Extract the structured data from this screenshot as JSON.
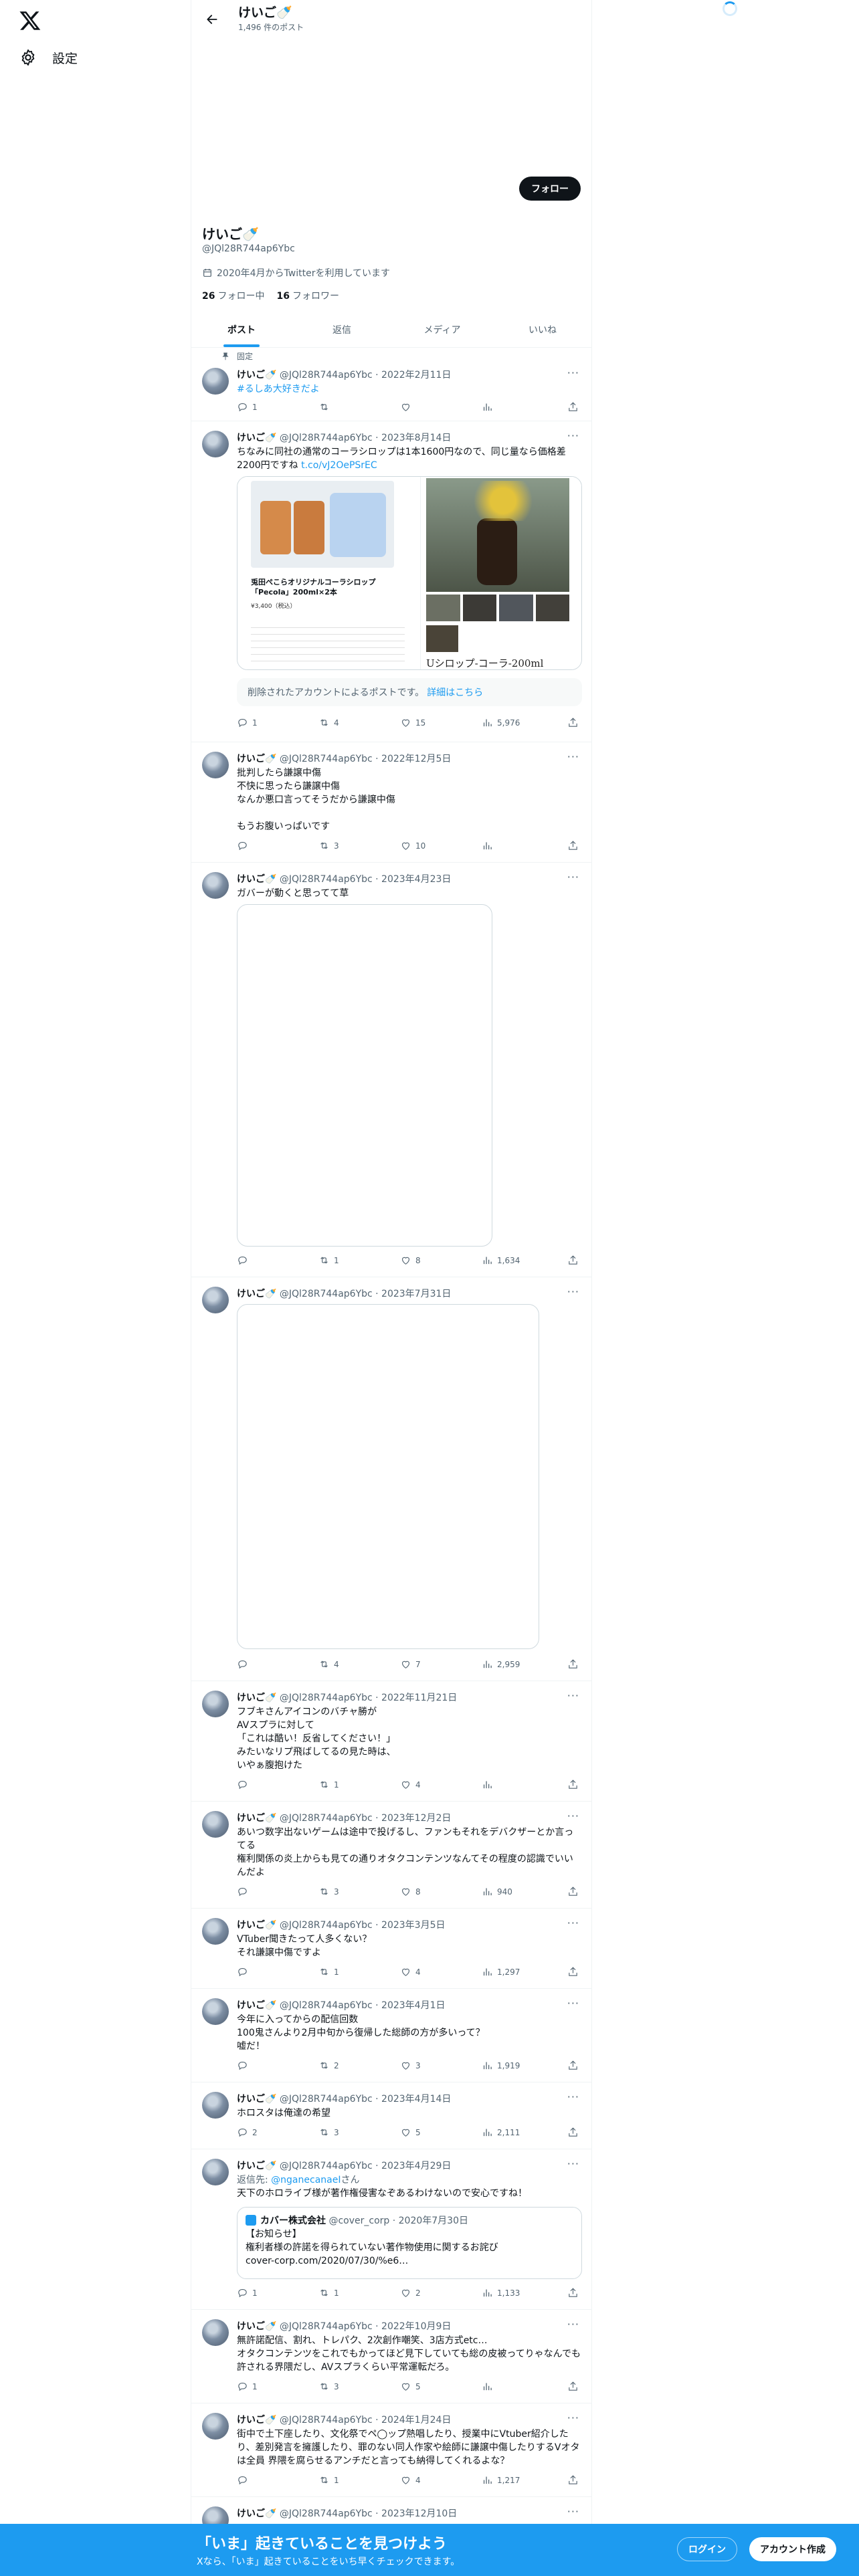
{
  "colors": {
    "accent": "#1d9bf0",
    "text": "#0f1419",
    "muted": "#536471"
  },
  "left": {
    "settings_label": "設定"
  },
  "header": {
    "name": "けいご🍼",
    "post_count": "1,496 件のポスト"
  },
  "profile": {
    "follow_label": "フォロー",
    "name": "けいご🍼",
    "handle": "@JQl28R744ap6Ybc",
    "joined": "2020年4月からTwitterを利用しています",
    "following_count": "26",
    "following_label": "フォロー中",
    "followers_count": "16",
    "followers_label": "フォロワー"
  },
  "tabs": [
    "ポスト",
    "返信",
    "メディア",
    "いいね"
  ],
  "pinned_label": "固定",
  "tweets": [
    {
      "name": "けいご🍼",
      "meta": "@JQl28R744ap6Ybc · 2022年2月11日",
      "text": "",
      "hashtag": "#るしあ大好きだよ",
      "reply": "1",
      "retweet": "",
      "like": "",
      "views": ""
    },
    {
      "name": "けいご🍼",
      "meta": "@JQl28R744ap6Ybc · 2023年8月14日",
      "text": "ちなみに同社の通常のコーラシロップは1本1600円なので、同じ量なら価格差2200円ですね ",
      "link": "t.co/vJ2OePSrEC",
      "card_left_title": "兎田ぺこらオリジナルコーラシロップ「Pecola」200ml×2本",
      "card_left_price": "¥3,400（税込）",
      "card_right_label": "Uシロップ-コーラ-200ml",
      "deleted_text": "削除されたアカウントによるポストです。",
      "deleted_link": "詳細はこちら",
      "reply": "1",
      "retweet": "4",
      "like": "15",
      "views": "5,976"
    },
    {
      "name": "けいご🍼",
      "meta": "@JQl28R744ap6Ybc · 2022年12月5日",
      "text": "批判したら謙譲中傷\n不快に思ったら謙譲中傷\nなんか悪口言ってそうだから謙譲中傷\n\nもうお腹いっぱいです",
      "reply": "",
      "retweet": "3",
      "like": "10",
      "views": ""
    },
    {
      "name": "けいご🍼",
      "meta": "@JQl28R744ap6Ybc · 2023年4月23日",
      "text": "ガバーが動くと思ってて草",
      "reply": "",
      "retweet": "1",
      "like": "8",
      "views": "1,634"
    },
    {
      "name": "けいご🍼",
      "meta": "@JQl28R744ap6Ybc · 2023年7月31日",
      "text": "",
      "reply": "",
      "retweet": "4",
      "like": "7",
      "views": "2,959"
    },
    {
      "name": "けいご🍼",
      "meta": "@JQl28R744ap6Ybc · 2022年11月21日",
      "text": "フブキさんアイコンのバチャ勝が\nAVスプラに対して\n「これは酷い！反省してください！」\nみたいなリプ飛ばしてるの見た時は、\nいやぁ腹抱けた",
      "reply": "",
      "retweet": "1",
      "like": "4",
      "views": ""
    },
    {
      "name": "けいご🍼",
      "meta": "@JQl28R744ap6Ybc · 2023年12月2日",
      "text": "あいつ数字出ないゲームは途中で投げるし、ファンもそれをデバクザーとか言ってる\n権利関係の炎上からも見ての通りオタクコンテンツなんてその程度の認識でいいんだよ",
      "reply": "",
      "retweet": "3",
      "like": "8",
      "views": "940"
    },
    {
      "name": "けいご🍼",
      "meta": "@JQl28R744ap6Ybc · 2023年3月5日",
      "text": "VTuber聞きたって人多くない？\nそれ謙譲中傷ですよ",
      "reply": "",
      "retweet": "1",
      "like": "4",
      "views": "1,297"
    },
    {
      "name": "けいご🍼",
      "meta": "@JQl28R744ap6Ybc · 2023年4月1日",
      "text": "今年に入ってからの配信回数\n100鬼さんより2月中旬から復帰した総師の方が多いって？\n嘘だ！",
      "reply": "",
      "retweet": "2",
      "like": "3",
      "views": "1,919"
    },
    {
      "name": "けいご🍼",
      "meta": "@JQl28R744ap6Ybc · 2023年4月14日",
      "text": "ホロスタは俺達の希望",
      "reply": "2",
      "retweet": "3",
      "like": "5",
      "views": "2,111"
    },
    {
      "name": "けいご🍼",
      "meta": "@JQl28R744ap6Ybc · 2023年4月29日",
      "reply_to_prefix": "返信先: ",
      "reply_to": "@nganecanaeI",
      "reply_to_suffix": "さん",
      "text": "天下のホロライブ様が著作権侵害なぞあるわけないので安心ですね！",
      "quote_name": "カバー株式会社",
      "quote_meta": "@cover_corp · 2020年7月30日",
      "quote_text": "【お知らせ】\n権利者様の許諾を得られていない著作物使用に関するお詫び\ncover-corp.com/2020/07/30/%e6…",
      "reply": "1",
      "retweet": "1",
      "like": "2",
      "views": "1,133"
    },
    {
      "name": "けいご🍼",
      "meta": "@JQl28R744ap6Ybc · 2022年10月9日",
      "text": "無許諾配信、割れ、トレパク、2次創作嘲笑、3店方式etc…\nオタクコンテンツをこれでもかってほど見下していても総の皮被ってりゃなんでも許される界隈だし、AVスプラくらい平常運転だろ。",
      "reply": "1",
      "retweet": "3",
      "like": "5",
      "views": ""
    },
    {
      "name": "けいご🍼",
      "meta": "@JQl28R744ap6Ybc · 2024年1月24日",
      "text": "街中で土下座したり、文化祭でペ◯ップ熱唱したり、授業中にVtuber紹介したり、差別発言を擁護したり、罪のない同人作家や絵師に謙譲中傷したりするVオタは全員 界隈を腐らせるアンチだと言っても納得してくれるよな？",
      "reply": "",
      "retweet": "1",
      "like": "4",
      "views": "1,217"
    },
    {
      "name": "けいご🍼",
      "meta": "@JQl28R744ap6Ybc · 2023年12月10日",
      "text": "",
      "reply": "",
      "retweet": "",
      "like": "",
      "views": ""
    }
  ],
  "bottom": {
    "title": "「いま」起きていることを見つけよう",
    "subtitle": "Xなら、「いま」起きていることをいち早くチェックできます。",
    "login": "ログイン",
    "signup": "アカウント作成"
  }
}
